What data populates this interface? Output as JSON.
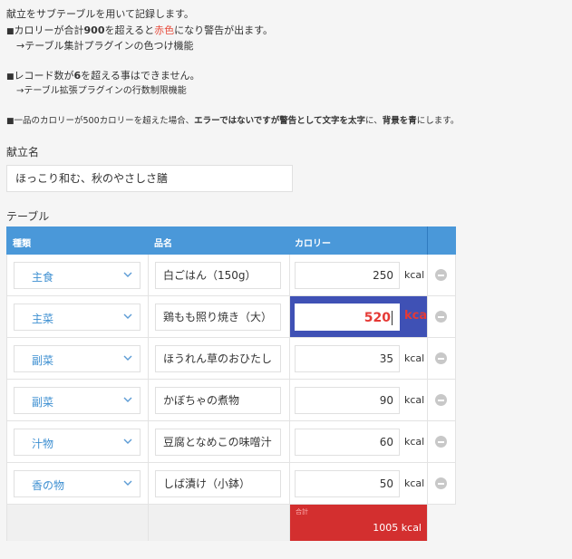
{
  "description": {
    "line1": "献立をサブテーブルを用いて記録します。",
    "line2_pre": "カロリーが合計",
    "line2_num": "900",
    "line2_mid": "を超えると",
    "line2_red": "赤色",
    "line2_post": "になり警告が出ます。",
    "line3": "→テーブル集計プラグインの色つけ機能",
    "line4_pre": "レコード数が",
    "line4_num": "6",
    "line4_post": "を超える事はできません。",
    "line5": "→テーブル拡張プラグインの行数制限機能",
    "line6_pre": "一品のカロリーが500カロリーを超えた場合、",
    "line6_bold1": "エラーではないですが警告として文字を太字",
    "line6_mid": "に、",
    "line6_bold2": "背景を青",
    "line6_post": "にします。",
    "bullet": "■"
  },
  "menu_name_label": "献立名",
  "menu_name_value": "ほっこり和む、秋のやさしさ膳",
  "table_label": "テーブル",
  "table": {
    "headers": {
      "type": "種類",
      "name": "品名",
      "calorie": "カロリー"
    },
    "unit": "kcal",
    "rows": [
      {
        "type": "主食",
        "name": "白ごはん（150g）",
        "calorie": "250",
        "warn": false
      },
      {
        "type": "主菜",
        "name": "鶏もも照り焼き（大）",
        "calorie": "520",
        "warn": true
      },
      {
        "type": "副菜",
        "name": "ほうれん草のおひたし",
        "calorie": "35",
        "warn": false
      },
      {
        "type": "副菜",
        "name": "かぼちゃの煮物",
        "calorie": "90",
        "warn": false
      },
      {
        "type": "汁物",
        "name": "豆腐となめこの味噌汁",
        "calorie": "60",
        "warn": false
      },
      {
        "type": "香の物",
        "name": "しば漬け（小鉢）",
        "calorie": "50",
        "warn": false
      }
    ],
    "total_label": "合計",
    "total_value": "1005 kcal"
  },
  "colors": {
    "header": "#4a98d9",
    "warn_bg": "#3f51b5",
    "warn_text": "#e53935",
    "total_bg": "#d32f2f"
  }
}
